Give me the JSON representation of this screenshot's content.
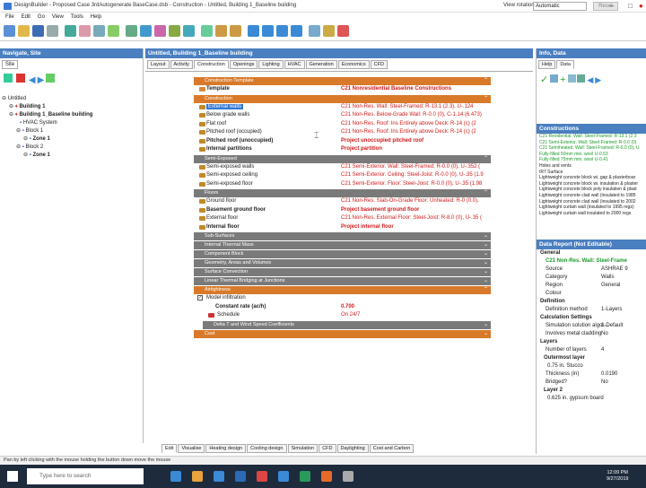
{
  "window": {
    "title": "DesignBuilder - Proposed Case 3rdAutogenerate BaseCase.dsb - Construction - Untitled, Building 1_Baseline building",
    "view_rotation_label": "View rotation",
    "view_rotation_value": "Automatic",
    "reset_label": "Reset"
  },
  "menu": [
    "File",
    "Edit",
    "Go",
    "View",
    "Tools",
    "Help"
  ],
  "left_panel": {
    "header": "Navigate, Site",
    "tab": "Site",
    "tree": [
      {
        "label": "Untitled",
        "bold": false
      },
      {
        "label": "Building 1",
        "bold": true
      },
      {
        "label": "Building 1_Baseline building",
        "bold": true
      },
      {
        "label": "HVAC System",
        "bold": false
      },
      {
        "label": "Block 1",
        "bold": false
      },
      {
        "label": "Zone 1",
        "bold": true
      },
      {
        "label": "Block 2",
        "bold": false
      },
      {
        "label": "Zone 1",
        "bold": true
      }
    ]
  },
  "center": {
    "header": "Untitled, Building 1_Baseline building",
    "tabs": [
      "Layout",
      "Activity",
      "Construction",
      "Openings",
      "Lighting",
      "HVAC",
      "Generation",
      "Economics",
      "CFD"
    ],
    "active_tab": "Construction",
    "sections": {
      "template_head": "Construction Template",
      "construction_head": "Construction",
      "semi_head": "Semi-Exposed",
      "floors_head": "Floors",
      "sub_surfaces": "Sub-Surfaces",
      "internal_thermal_mass": "Internal Thermal Mass",
      "component_block": "Component Block",
      "geometry": "Geometry, Areas and Volumes",
      "surface_convection": "Surface Convection",
      "linear_bridging": "Linear Thermal Bridging at Junctions",
      "airtightness": "Airtightness",
      "delta_t": "Delta T and Wind Speed Coefficients",
      "cost": "Cost"
    },
    "template": {
      "label": "Template",
      "value": "C21 Nonresidential Baseline Constructions"
    },
    "construction_rows": [
      {
        "label": "External walls",
        "value": "C21 Non-Res. Wall: Steel-Framed: R-13.1 (2.3), U-.124",
        "bold": false,
        "selected": true
      },
      {
        "label": "Below grade walls",
        "value": "C21 Non-Res. Below-Grade Wall: R-0.0 (0), C-1.14 (6.473)",
        "bold": false
      },
      {
        "label": "Flat roof",
        "value": "C21 Non-Res. Roof: Ins Entirely above Deck: R-14 (c) (2",
        "bold": false
      },
      {
        "label": "Pitched roof (occupied)",
        "value": "C21 Non-Res. Roof: Ins Entirely above Deck: R-14 (c) (2",
        "bold": false
      },
      {
        "label": "Pitched roof (unoccupied)",
        "value": "Project unoccupied pitched roof",
        "bold": true
      },
      {
        "label": "Internal partitions",
        "value": "Project partition",
        "bold": true
      }
    ],
    "semi_rows": [
      {
        "label": "Semi-exposed walls",
        "value": "C21 Semi-Exterior. Wall: Steel-Framed: R-0.0 (0), U-.352 (",
        "bold": false
      },
      {
        "label": "Semi-exposed ceiling",
        "value": "C21 Semi-Exterior. Ceiling: Steel-Joist: R-0.0 (0), U-.35 (1.9",
        "bold": false
      },
      {
        "label": "Semi-exposed floor",
        "value": "C21 Semi-Exterior. Floor: Steel-Joist: R-0.0 (0), U-.35 (1.98",
        "bold": false
      }
    ],
    "floor_rows": [
      {
        "label": "Ground floor",
        "value": "C21 Non-Res. Slab-On-Grade Floor: Unheated: R-0 (0.0),",
        "bold": false
      },
      {
        "label": "Basement ground floor",
        "value": "Project basement ground floor",
        "bold": true
      },
      {
        "label": "External floor",
        "value": "C21 Non-Res. External Floor: Steel-Joist: R-8.0 (0), U-.35 (",
        "bold": false
      },
      {
        "label": "Internal floor",
        "value": "Project internal floor",
        "bold": true
      }
    ],
    "model_infiltration": "Model infiltration",
    "constant_rate_label": "Constant rate (ac/h)",
    "constant_rate_value": "0.700",
    "schedule_label": "Schedule",
    "schedule_value": "On 24/7",
    "bottom_tabs": [
      "Edit",
      "Visualise",
      "Heating design",
      "Cooling design",
      "Simulation",
      "CFD",
      "Daylighting",
      "Cost and Carbon"
    ]
  },
  "right_panel": {
    "header": "Info, Data",
    "tabs": [
      "Help",
      "Data"
    ],
    "constructions_head": "Constructions",
    "list": [
      {
        "label": "C21 Residential. Wall: Steel-Framed: R-13.1 (2.3",
        "green": true
      },
      {
        "label": "C21 Semi-Exterior. Wall: Steel-Framed: R-0.0 (0)",
        "green": true
      },
      {
        "label": "C21 Semiheated. Wall: Steel-Framed: R-0.0 (0), U",
        "green": true
      },
      {
        "label": "Fully-filled 50mm min. wool U-0.53",
        "green": true
      },
      {
        "label": "Fully-filled 75mm min. wool U-0.41",
        "green": true
      },
      {
        "label": "Holes and vents",
        "green": false
      },
      {
        "label": "IR7 Surface",
        "green": false
      },
      {
        "label": "Lightweight concrete block wi. gap & plasterboar",
        "green": false
      },
      {
        "label": "Lightweight concrete block wi. insulation & plaster",
        "green": false
      },
      {
        "label": "Lightweight concrete block poly insulation & plast",
        "green": false
      },
      {
        "label": "Lightweight concrete clad wall (insulated to 1985",
        "green": false
      },
      {
        "label": "Lightweight concrete clad wall (insulated to 2002",
        "green": false
      },
      {
        "label": "Lightweight curtain wall (insulated to 1995 regs)",
        "green": false
      },
      {
        "label": "Lightweight curtain wall insulated to 2000 regs",
        "green": false
      }
    ],
    "data_report_head": "Data Report (Not Editable)",
    "general": "General",
    "construction_name": "C21 Non-Res. Wall: Steel-Frame",
    "rows1": [
      {
        "k": "Source",
        "v": "ASHRAE 9"
      },
      {
        "k": "Category",
        "v": "Walls"
      },
      {
        "k": "Region",
        "v": "General"
      },
      {
        "k": "Colour",
        "v": ""
      }
    ],
    "definition": "Definition",
    "definition_method": {
      "k": "Definition method",
      "v": "1-Layers"
    },
    "calc_settings": "Calculation Settings",
    "rows2": [
      {
        "k": "Simulation solution algor...",
        "v": "1-Default"
      },
      {
        "k": "Involves metal cladding",
        "v": "No"
      }
    ],
    "layers": "Layers",
    "num_layers": {
      "k": "Number of layers",
      "v": "4"
    },
    "outermost": "Outermost layer",
    "stucco": "0.75 in. Stucco",
    "thickness": {
      "k": "Thickness (in)",
      "v": "0.0190"
    },
    "bridged": {
      "k": "Bridged?",
      "v": "No"
    },
    "layer2": "Layer 2",
    "gypsum": "0.625 in. gypsum board"
  },
  "status": "Pan by left clicking with the mouse holding the button down move the mouse",
  "taskbar": {
    "search": "Type here to search",
    "time": "12:09 PM",
    "date": "9/27/2019"
  }
}
